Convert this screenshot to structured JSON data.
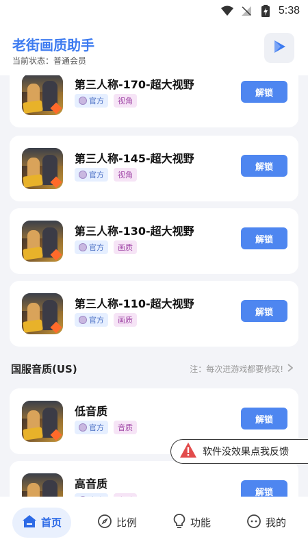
{
  "status_bar": {
    "time": "5:38"
  },
  "header": {
    "title": "老街画质助手",
    "status": "当前状态：普通会员"
  },
  "cards_top": [
    {
      "title": "第三人称-170-超大视野",
      "tag_official": "官方",
      "tag_category": "视角",
      "button": "解锁"
    },
    {
      "title": "第三人称-145-超大视野",
      "tag_official": "官方",
      "tag_category": "视角",
      "button": "解锁"
    },
    {
      "title": "第三人称-130-超大视野",
      "tag_official": "官方",
      "tag_category": "画质",
      "button": "解锁"
    },
    {
      "title": "第三人称-110-超大视野",
      "tag_official": "官方",
      "tag_category": "画质",
      "button": "解锁"
    }
  ],
  "section": {
    "title": "国服音质(US)",
    "note": "注：每次进游戏都要修改!"
  },
  "cards_audio": [
    {
      "title": "低音质",
      "tag_official": "官方",
      "tag_category": "音质",
      "button": "解锁"
    },
    {
      "title": "高音质",
      "tag_official": "官方",
      "tag_category": "音质",
      "button": "解锁"
    }
  ],
  "feedback": {
    "label": "软件没效果点我反馈"
  },
  "bottom_nav": [
    {
      "label": "首页",
      "icon": "home-icon",
      "active": true
    },
    {
      "label": "比例",
      "icon": "compass-icon",
      "active": false
    },
    {
      "label": "功能",
      "icon": "lightbulb-icon",
      "active": false
    },
    {
      "label": "我的",
      "icon": "profile-icon",
      "active": false
    }
  ],
  "colors": {
    "accent": "#3d7bf0",
    "button": "#4e86f0",
    "warning": "#e24b4b"
  }
}
